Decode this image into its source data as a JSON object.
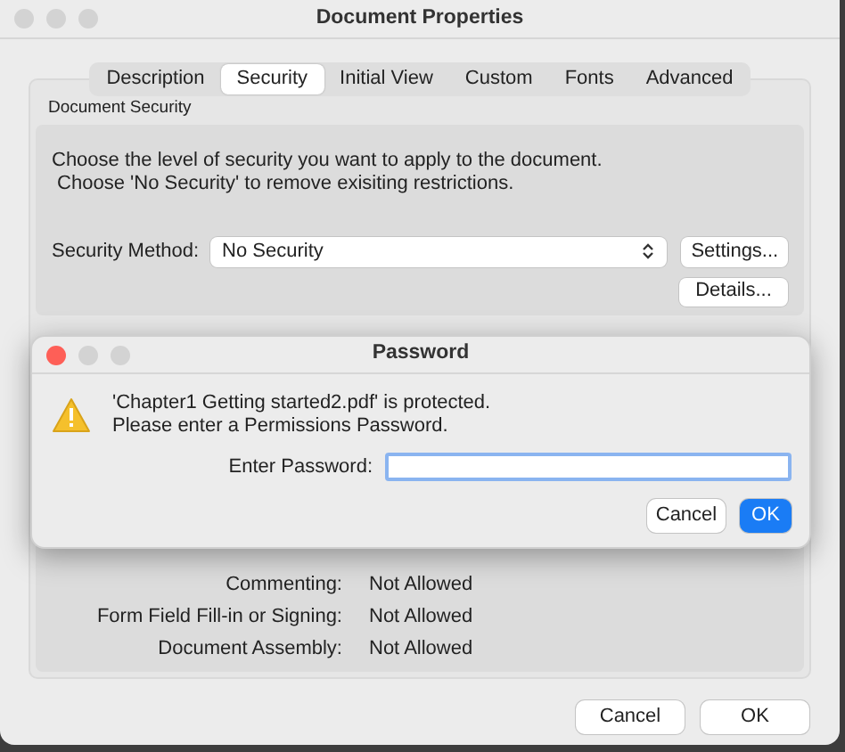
{
  "window": {
    "title": "Document Properties"
  },
  "tabs": [
    {
      "label": "Description",
      "selected": false
    },
    {
      "label": "Security",
      "selected": true
    },
    {
      "label": "Initial View",
      "selected": false
    },
    {
      "label": "Custom",
      "selected": false
    },
    {
      "label": "Fonts",
      "selected": false
    },
    {
      "label": "Advanced",
      "selected": false
    }
  ],
  "section_title": "Document Security",
  "description": [
    "Choose the level of security you want to apply to the document.",
    " Choose 'No Security' to remove exisiting restrictions."
  ],
  "security_method": {
    "label": "Security Method:",
    "value": "No Security"
  },
  "security_buttons": [
    "Settings...",
    "Details..."
  ],
  "restrictions": [
    {
      "label": "Commenting:",
      "value": "Not Allowed"
    },
    {
      "label": "Form Field Fill-in or Signing:",
      "value": "Not Allowed"
    },
    {
      "label": "Document Assembly:",
      "value": "Not Allowed"
    }
  ],
  "buttons": [
    {
      "label": "Cancel",
      "default": false
    },
    {
      "label": "OK",
      "default": false
    }
  ],
  "password_dialog": {
    "title": "Password",
    "message": [
      "'Chapter1 Getting started2.pdf' is protected.",
      "Please enter a Permissions Password."
    ],
    "field_label": "Enter Password:",
    "focused": true,
    "buttons": [
      {
        "label": "Cancel",
        "default": false
      },
      {
        "label": "OK",
        "default": true
      }
    ]
  }
}
